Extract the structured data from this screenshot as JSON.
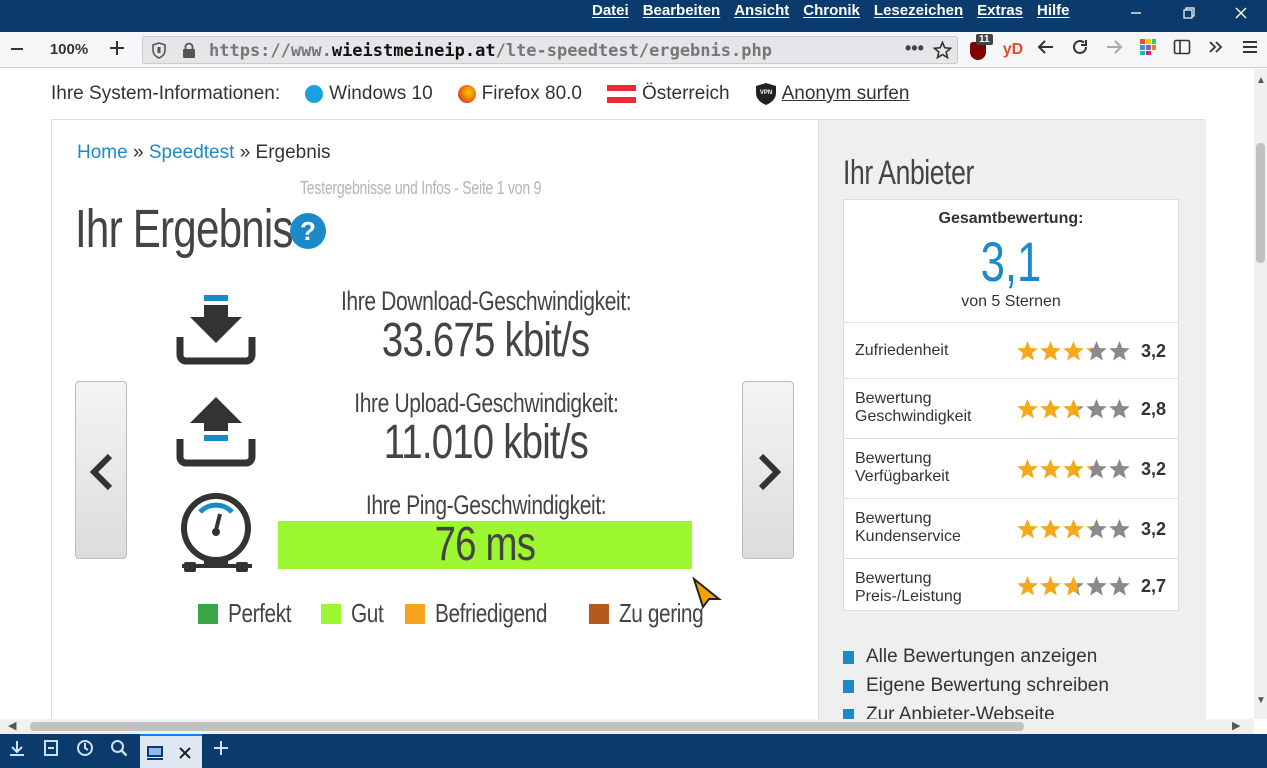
{
  "menu": [
    "Datei",
    "Bearbeiten",
    "Ansicht",
    "Chronik",
    "Lesezeichen",
    "Extras",
    "Hilfe"
  ],
  "toolbar": {
    "zoom": "100%",
    "url_prefix": "https://www.",
    "url_domain": "wieistmeineip.at",
    "url_path": "/lte-speedtest/ergebnis.php",
    "ublock_count": "11",
    "yd_label": "yD"
  },
  "sysinfo": {
    "label": "Ihre System-Informationen:",
    "os": "Windows 10",
    "browser": "Firefox 80.0",
    "country": "Österreich",
    "anon": "Anonym surfen"
  },
  "breadcrumb": {
    "home": "Home",
    "sep": "»",
    "speedtest": "Speedtest",
    "current": "Ergebnis"
  },
  "subtitle": "Testergebnisse und Infos - Seite 1 von 9",
  "heading": "Ihr Ergebnis",
  "help": "?",
  "download": {
    "label": "Ihre Download-Geschwindigkeit:",
    "value": "33.675 kbit/s"
  },
  "upload": {
    "label": "Ihre Upload-Geschwindigkeit:",
    "value": "11.010 kbit/s"
  },
  "ping": {
    "label": "Ihre Ping-Geschwindigkeit:",
    "value": "76 ms",
    "color": "#9cf630"
  },
  "legend": [
    {
      "label": "Perfekt",
      "color": "#3aa647"
    },
    {
      "label": "Gut",
      "color": "#9cf630"
    },
    {
      "label": "Befriedigend",
      "color": "#f7a21b"
    },
    {
      "label": "Zu gering",
      "color": "#b35a1f"
    }
  ],
  "provider": {
    "title": "Ihr Anbieter",
    "overall_label": "Gesamtbewertung:",
    "overall": "3,1",
    "overall_sub": "von 5 Sternen",
    "ratings": [
      {
        "label1": "Zufriedenheit",
        "label2": "",
        "value": "3,2",
        "stars": 3.2
      },
      {
        "label1": "Bewertung",
        "label2": "Geschwindigkeit",
        "value": "2,8",
        "stars": 2.8
      },
      {
        "label1": "Bewertung",
        "label2": "Verfügbarkeit",
        "value": "3,2",
        "stars": 3.2
      },
      {
        "label1": "Bewertung",
        "label2": "Kundenservice",
        "value": "3,2",
        "stars": 3.2
      },
      {
        "label1": "Bewertung",
        "label2": "Preis-/Leistung",
        "value": "2,7",
        "stars": 2.7
      }
    ],
    "links": [
      "Alle Bewertungen anzeigen",
      "Eigene Bewertung schreiben",
      "Zur Anbieter-Webseite"
    ]
  }
}
